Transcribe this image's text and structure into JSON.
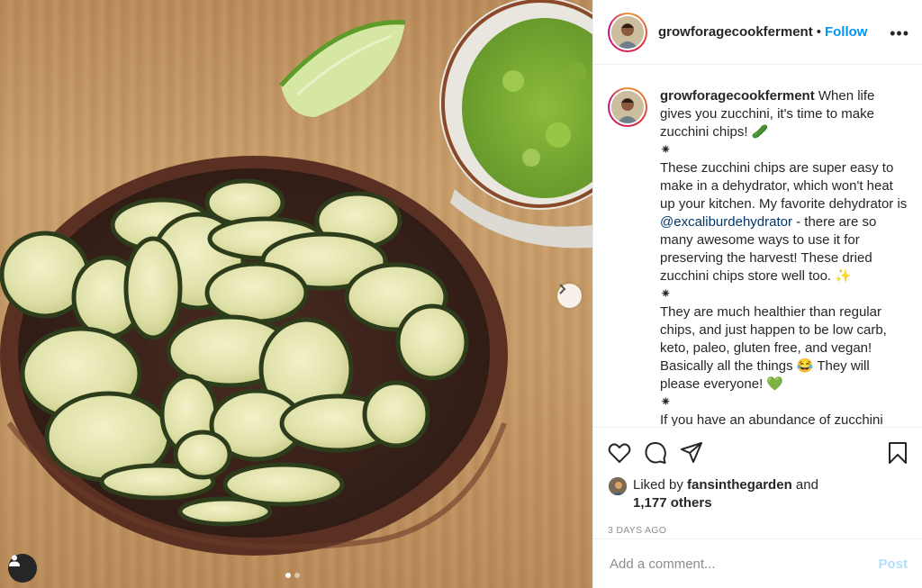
{
  "post": {
    "username": "growforagecookferment",
    "follow_label": "Follow",
    "separator": "•",
    "more_label": "•••"
  },
  "caption": {
    "username": "growforagecookferment",
    "p1": "When life gives you zucchini, it's time to make zucchini chips! 🥒",
    "sep1": "⁕",
    "p2_before": "These zucchini chips are super easy to make in a dehydrator, which won't heat up your kitchen. My favorite dehydrator is ",
    "mention": "@excaliburdehydrator",
    "p2_after": " - there are so many awesome ways to use it for preserving the harvest! These dried zucchini chips store well too. ✨",
    "sep2": "⁕",
    "p3": "They are much healthier than regular chips, and just happen to be low carb, keto, paleo, gluten free, and vegan! Basically all the things 😂 They will please everyone! 💚",
    "sep3": "⁕",
    "p4": "If you have an abundance of zucchini"
  },
  "likes": {
    "prefix": "Liked by",
    "user": "fansinthegarden",
    "and": "and",
    "others": "1,177 others"
  },
  "timestamp": "3 DAYS AGO",
  "comment": {
    "placeholder": "Add a comment...",
    "post_label": "Post"
  },
  "carousel": {
    "slides": 2,
    "active": 1
  },
  "icons": [
    "heart-icon",
    "comment-icon",
    "share-icon",
    "bookmark-icon",
    "chevron-right-icon",
    "user-tag-icon"
  ],
  "colors": {
    "accent": "#0095f6",
    "post_disabled": "#b2dffc",
    "muted": "#8e8e8e"
  }
}
